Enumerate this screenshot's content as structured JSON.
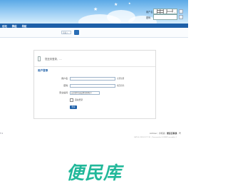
{
  "header": {
    "login_username_label": "用户名",
    "login_username_placeholder": "用户名/Email",
    "login_password_label": "密码"
  },
  "nav": {
    "items": [
      "论坛",
      "群组",
      "导航"
    ]
  },
  "search": {
    "placeholder": "请输入"
  },
  "panel": {
    "notice": "您还未登录，....",
    "title": "用户登录",
    "username_label": "用户名:",
    "username_hint": "立即注册",
    "password_label": "密码:",
    "password_hint": "找回密码",
    "question_label": "安全提问:",
    "question_selected": "安全提问(未设置请忽略)",
    "remember_label": "自动登录",
    "submit_label": "登录"
  },
  "footer": {
    "left_text": "© 2",
    "links": [
      "Archiver",
      "手机版",
      "便民百事通",
      "粤"
    ],
    "sub_text": "GMT+8, 2024-3-27 7:41 , Processed in 0.019092 second(s), 1"
  },
  "watermark": {
    "text": "便民库"
  },
  "colors": {
    "nav_bg": "#1d5fa8",
    "header_sky": "#5aa9e6",
    "watermark": "#22b89a"
  }
}
